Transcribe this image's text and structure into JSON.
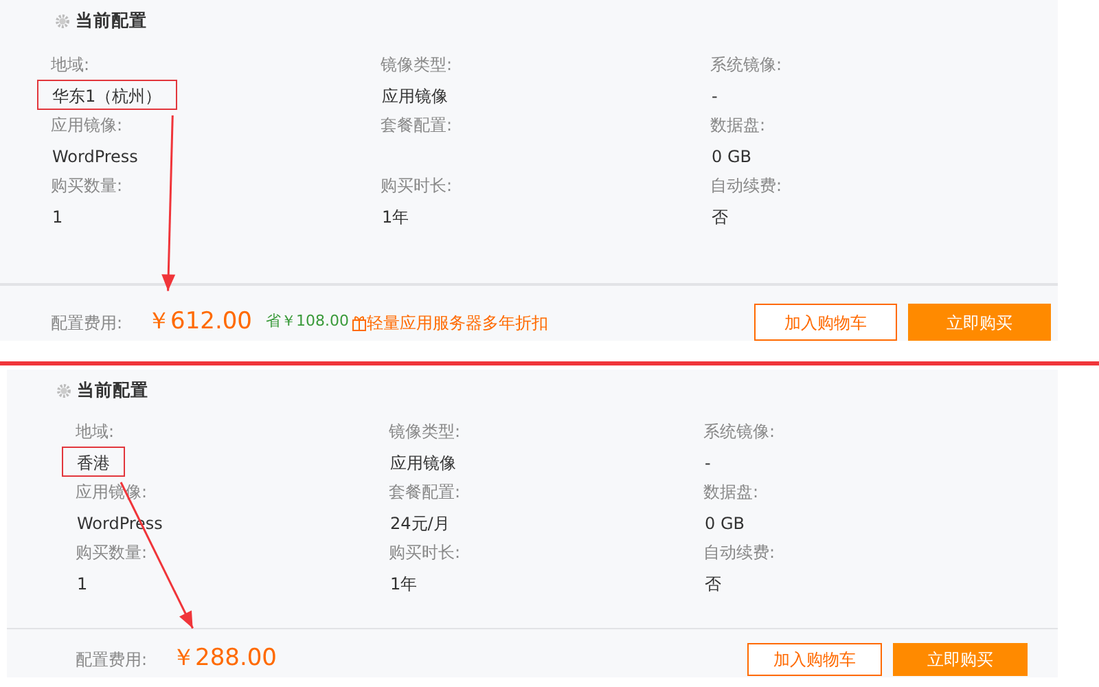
{
  "panels": [
    {
      "title": "当前配置",
      "fields": [
        {
          "label": "地域:",
          "value": "华东1（杭州）",
          "highlighted": true
        },
        {
          "label": "镜像类型:",
          "value": "应用镜像",
          "highlighted": false
        },
        {
          "label": "系统镜像:",
          "value": "-",
          "highlighted": false
        },
        {
          "label": "应用镜像:",
          "value": "WordPress",
          "highlighted": false
        },
        {
          "label": "套餐配置:",
          "highlighted": false
        },
        {
          "label": "数据盘:",
          "value": "0 GB",
          "highlighted": false
        },
        {
          "label": "购买数量:",
          "value": "1",
          "highlighted": false
        },
        {
          "label": "购买时长:",
          "value": "1年",
          "highlighted": false
        },
        {
          "label": "自动续费:",
          "value": "否",
          "highlighted": false
        }
      ],
      "price_label": "配置费用:",
      "price": "￥612.00",
      "saving": "省￥108.00",
      "promo": "轻量应用服务器多年折扣",
      "buttons": [
        {
          "label": "加入购物车",
          "kind": "outline"
        },
        {
          "label": "立即购买",
          "kind": "solid"
        }
      ]
    },
    {
      "title": "当前配置",
      "fields": [
        {
          "label": "地域:",
          "value": "香港",
          "highlighted": true
        },
        {
          "label": "镜像类型:",
          "value": "应用镜像",
          "highlighted": false
        },
        {
          "label": "系统镜像:",
          "value": "-",
          "highlighted": false
        },
        {
          "label": "应用镜像:",
          "value": "WordPress",
          "highlighted": false
        },
        {
          "label": "套餐配置:",
          "value": "24元/月",
          "highlighted": false
        },
        {
          "label": "数据盘:",
          "value": "0 GB",
          "highlighted": false
        },
        {
          "label": "购买数量:",
          "value": "1",
          "highlighted": false
        },
        {
          "label": "购买时长:",
          "value": "1年",
          "highlighted": false
        },
        {
          "label": "自动续费:",
          "value": "否",
          "highlighted": false
        }
      ],
      "price_label": "配置费用:",
      "price": "￥288.00",
      "buttons": [
        {
          "label": "加入购物车",
          "kind": "outline"
        },
        {
          "label": "立即购买",
          "kind": "solid"
        }
      ]
    }
  ]
}
